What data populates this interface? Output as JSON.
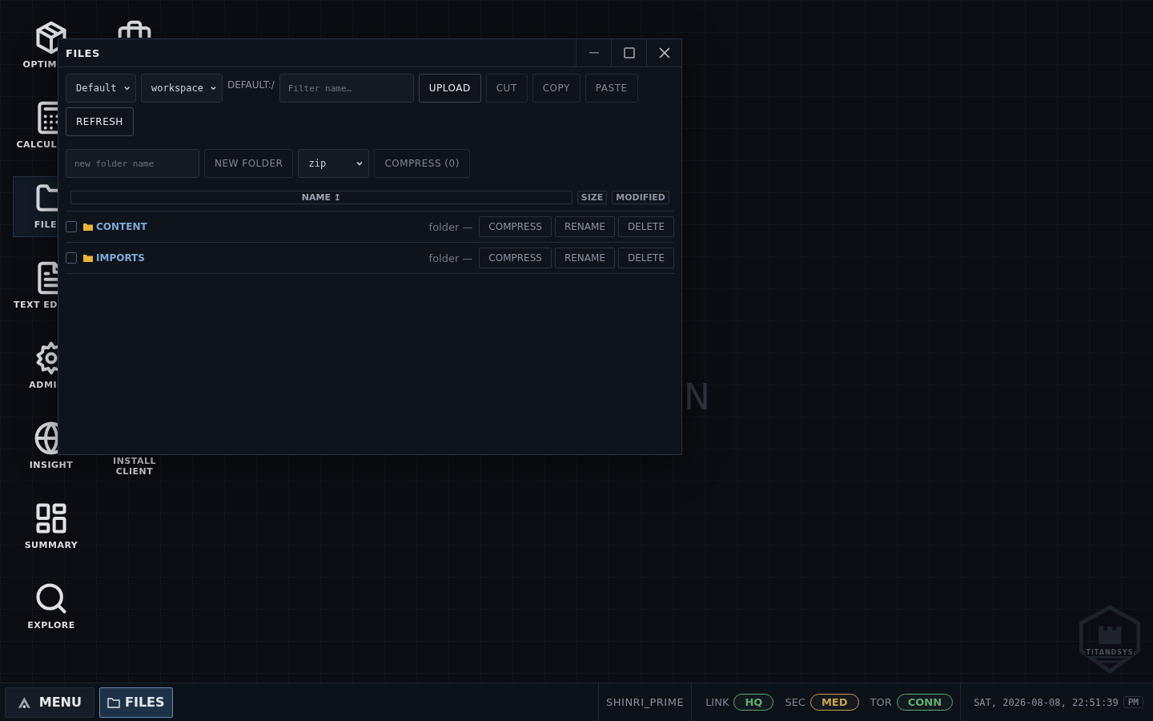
{
  "desktop": {
    "columns": [
      [
        {
          "label": "OPTIM",
          "selected": false
        },
        {
          "label": "CALCUL",
          "selected": false
        },
        {
          "label": "FILE",
          "selected": true
        },
        {
          "label": "TEXT ED",
          "selected": false
        },
        {
          "label": "ADMI",
          "selected": false
        },
        {
          "label": "INSIGHT",
          "selected": false
        },
        {
          "label": "SUMMARY",
          "selected": false
        },
        {
          "label": "EXPLORE",
          "selected": false
        }
      ],
      [
        {
          "kind": "icon"
        },
        {
          "kind": "label",
          "label": "INSTALL CLIENT"
        }
      ]
    ],
    "backdrop_text": "N",
    "logo_text": "TITANDSYS"
  },
  "window": {
    "title": "FILES",
    "toolbar": {
      "drive": "Default",
      "scope": "workspace",
      "path": "DEFAULT:/",
      "filter_placeholder": "Filter name…",
      "buttons": [
        {
          "label": "UPLOAD",
          "disabled": false
        },
        {
          "label": "CUT",
          "disabled": true
        },
        {
          "label": "COPY",
          "disabled": true
        },
        {
          "label": "PASTE",
          "disabled": true
        },
        {
          "label": "REFRESH",
          "disabled": false
        }
      ]
    },
    "create": {
      "folder_placeholder": "new folder name",
      "new_folder_button": "NEW FOLDER",
      "format": "zip",
      "compress_button": "COMPRESS (0)"
    },
    "table": {
      "columns": [
        {
          "label": "NAME ↥",
          "selected": true
        },
        {
          "label": "SIZE",
          "selected": false
        },
        {
          "label": "MODIFIED",
          "selected": false
        }
      ],
      "rows": [
        {
          "name": "CONTENT",
          "checked": false,
          "type": "folder",
          "modified": "—",
          "actions": [
            "COMPRESS",
            "RENAME",
            "DELETE"
          ]
        },
        {
          "name": "IMPORTS",
          "checked": false,
          "type": "folder",
          "modified": "—",
          "actions": [
            "COMPRESS",
            "RENAME",
            "DELETE"
          ]
        }
      ]
    }
  },
  "taskbar": {
    "menu": "MENU",
    "tasks": [
      {
        "label": "FILES",
        "selected": true
      }
    ],
    "host": "SHINRI_PRIME",
    "status": [
      {
        "label": "LINK",
        "value": "HQ",
        "color": "#5fae72"
      },
      {
        "label": "SEC",
        "value": "MED",
        "color": "#c9a24a"
      },
      {
        "label": "TOR",
        "value": "CONN",
        "color": "#5fae72"
      }
    ],
    "clock": "SAT, 2026-08-08, 22:51:39",
    "meridiem": "PM"
  }
}
